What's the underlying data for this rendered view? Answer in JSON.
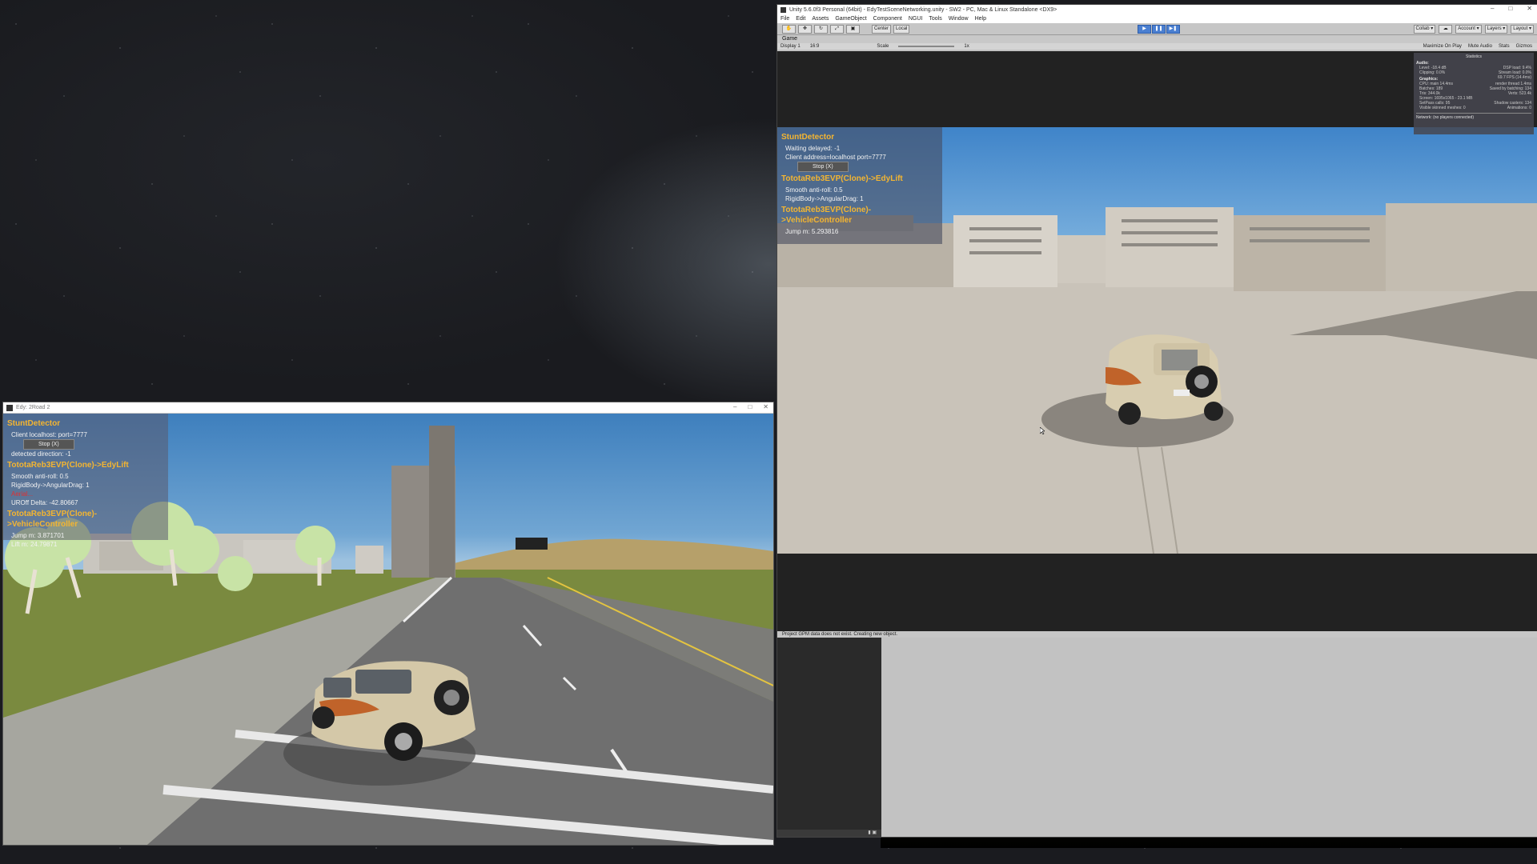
{
  "left_window": {
    "title": "Edy: 2Road 2",
    "overlay": {
      "stunt_detector": "StuntDetector",
      "connection": "Client localhost: port=7777",
      "stop_button": "Stop (X)",
      "detected_direction": "detected direction: -1",
      "edy_lift_title": "TototaReb3EVP(Clone)->EdyLift",
      "smooth_antiroll": "Smooth anti-roll: 0.5",
      "angular_drag": "RigidBody->AngularDrag: 1",
      "red_label": "Aerial...",
      "uroff_delta": "UROff Delta: -42.80667",
      "vehicle_controller_title": "TototaReb3EVP(Clone)->VehicleController",
      "jump": "Jump m: 3.871701",
      "lift": "Lift m: 24.79871"
    },
    "window_buttons": [
      "–",
      "□",
      "✕"
    ]
  },
  "unity": {
    "title": "Unity 5.6.0f3 Personal (64bit) - EdyTestSceneNetworking.unity - SW2 - PC, Mac & Linux Standalone <DX9>",
    "menu": [
      "File",
      "Edit",
      "Assets",
      "GameObject",
      "Component",
      "NGUI",
      "Tools",
      "Window",
      "Help"
    ],
    "toolbar": {
      "center_label": "Center",
      "local_label": "Local",
      "collab_label": "Collab ▾",
      "account_label": "Account ▾",
      "layers_label": "Layers ▾",
      "layout_label": "Layout ▾"
    },
    "game_tab": "Game",
    "gamebar": {
      "display": "Display 1",
      "aspect": "16:9",
      "scale_label": "Scale",
      "scale_value": "1x",
      "maximize": "Maximize On Play",
      "mute": "Mute Audio",
      "stats": "Stats",
      "gizmos": "Gizmos"
    },
    "overlay": {
      "stunt_detector": "StuntDetector",
      "waiting": "Waiting delayed: -1",
      "client": "Client address=localhost port=7777",
      "stop_button": "Stop (X)",
      "edy_lift_title": "TototaReb3EVP(Clone)->EdyLift",
      "smooth_antiroll": "Smooth anti-roll: 0.5",
      "angular_drag": "RigidBody->AngularDrag: 1",
      "vehicle_controller_title": "TototaReb3EVP(Clone)->VehicleController",
      "jump": "Jump m: 5.293816"
    },
    "statistics": {
      "title": "Statistics",
      "audio_head": "Audio:",
      "level": "Level: -18.4 dB",
      "dsp_load": "DSP load: 9.4%",
      "clipping": "Clipping: 0.0%",
      "stream_load": "Stream load: 0.0%",
      "graphics_head": "Graphics:",
      "fps": "69.7 FPS (14.4ms)",
      "cpu": "CPU: main 14.4ms",
      "render_thread": "render thread 1.4ms",
      "batches": "Batches: 189",
      "saved_batching": "Saved by batching: 134",
      "tris": "Tris: 344.0k",
      "verts": "Verts: 523.4k",
      "screen": "Screen: 1695x1065 - 23.1 MB",
      "setpass": "SetPass calls: 95",
      "shadow_casters": "Shadow casters: 134",
      "visible_skinned": "Visible skinned meshes: 0",
      "animations": "Animations: 0",
      "network": "Network: (no players connected)"
    },
    "console_message": "Project GPM data does not exist. Creating new object."
  },
  "colors": {
    "overlay_heading": "#f4b531",
    "unity_chrome": "#c2c2c2",
    "play_button": "#4a7fd1",
    "tent_green": "#9acd32"
  },
  "icons": [
    "unity-logo-icon",
    "hand-tool-icon",
    "move-tool-icon",
    "rotate-tool-icon",
    "scale-tool-icon",
    "rect-tool-icon",
    "play-icon",
    "pause-icon",
    "step-icon",
    "mouse-cursor-icon"
  ]
}
